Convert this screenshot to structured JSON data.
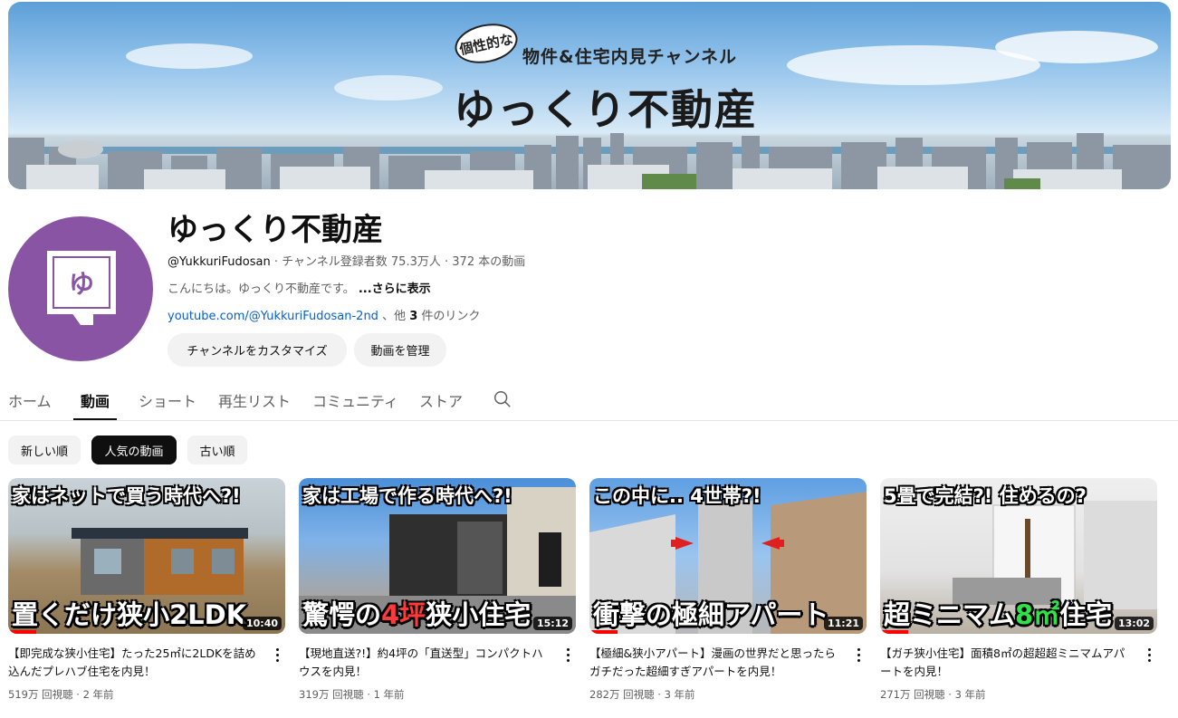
{
  "banner": {
    "badge": "個性的な",
    "subtitle": "物件&住宅内見チャンネル",
    "title": "ゆっくり不動産"
  },
  "avatar": {
    "glyph": "ゆ",
    "color": "#8a54a5"
  },
  "channel": {
    "name": "ゆっくり不動産",
    "handle": "@YukkuriFudosan",
    "subscribers": "チャンネル登録者数 75.3万人",
    "videos": "372 本の動画",
    "separator": "‧",
    "description": "こんにちは。ゆっくり不動産です。",
    "more": "...さらに表示",
    "link_url": "youtube.com/@YukkuriFudosan-2nd",
    "link_sep": "、他",
    "link_count": "3",
    "link_suffix": "件のリンク"
  },
  "buttons": {
    "customize": "チャンネルをカスタマイズ",
    "manage": "動画を管理"
  },
  "tabs": [
    {
      "label": "ホーム"
    },
    {
      "label": "動画",
      "active": true
    },
    {
      "label": "ショート"
    },
    {
      "label": "再生リスト"
    },
    {
      "label": "コミュニティ"
    },
    {
      "label": "ストア"
    }
  ],
  "chips": [
    {
      "label": "新しい順"
    },
    {
      "label": "人気の動画",
      "active": true
    },
    {
      "label": "古い順"
    }
  ],
  "videos": [
    {
      "thumb_top": "家はネットで買う時代へ?!",
      "thumb_bottom": "置くだけ狭小2LDK",
      "duration": "10:40",
      "title": "【即完成な狭小住宅】たった25㎡に2LDKを詰め込んだプレハブ住宅を内見！",
      "views": "519万 回視聴",
      "age": "2 年前",
      "progress": 0.1
    },
    {
      "thumb_top": "家は工場で作る時代へ?!",
      "thumb_bottom_a": "驚愕の",
      "thumb_bottom_b": "4坪",
      "thumb_bottom_c": "狭小住宅",
      "duration": "15:12",
      "title": "【現地直送?!】約4坪の「直送型」コンパクトハウスを内見！",
      "views": "319万 回視聴",
      "age": "1 年前",
      "progress": 0.0
    },
    {
      "thumb_top": "この中に..     4世帯?!",
      "thumb_bottom": "衝撃の極細アパート",
      "duration": "11:21",
      "title": "【極細&狭小アパート】漫画の世界だと思ったらガチだった超細すぎアパートを内見！",
      "views": "282万 回視聴",
      "age": "3 年前",
      "progress": 0.1
    },
    {
      "thumb_top": "5畳で完結?! 住めるの?",
      "thumb_bottom_a": "超ミニマム",
      "thumb_bottom_b": "8㎡",
      "thumb_bottom_c": "住宅",
      "duration": "13:02",
      "title": "【ガチ狭小住宅】面積8㎡の超超超ミニマムアパートを内見！",
      "views": "271万 回視聴",
      "age": "3 年前",
      "progress": 0.1
    }
  ],
  "meta_sep": "‧"
}
